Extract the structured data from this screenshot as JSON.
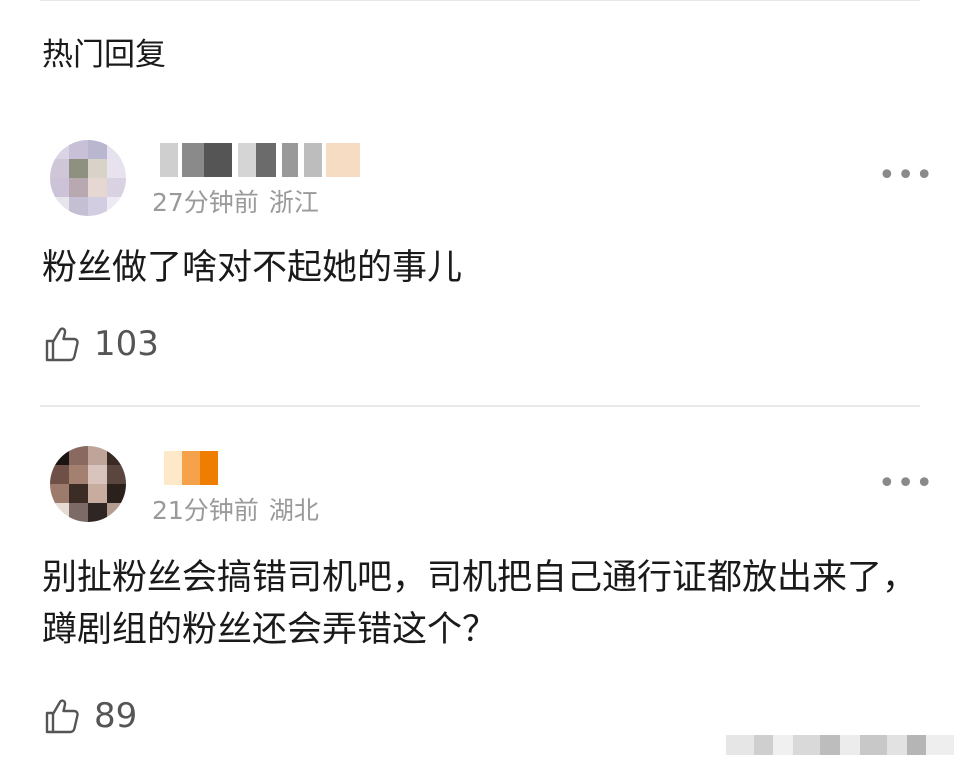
{
  "header": {
    "title": "热门回复"
  },
  "comments": [
    {
      "time": "27分钟前",
      "location": "浙江",
      "text": "粉丝做了啥对不起她的事儿",
      "likes": "103",
      "more": "•••",
      "colors": {
        "avatar": [
          "#d9d3e6",
          "#c7c0d6",
          "#b9b6d0",
          "#e5e1ee",
          "#cfc6d8",
          "#8e9080",
          "#d9d2c8",
          "#e7e2ee",
          "#cdc3d9",
          "#b8a8b0",
          "#e6d7d2",
          "#d8d2e2",
          "#e8e4ee",
          "#c5bfd4",
          "#d2cde0",
          "#eeeaf3"
        ],
        "username": [
          "#cfcfcf",
          "#ffffff",
          "#8a8a8a",
          "#555555",
          "#ffffff",
          "#d5d5d5",
          "#6b6b6b",
          "#ffffff",
          "#999999",
          "#ffffff",
          "#bdbdbd",
          "#ffffff",
          "#f7dcc4"
        ]
      }
    },
    {
      "time": "21分钟前",
      "location": "湖北",
      "text": "别扯粉丝会搞错司机吧，司机把自己通行证都放出来了，蹲剧组的粉丝还会弄错这个？",
      "likes": "89",
      "more": "•••",
      "colors": {
        "avatar": [
          "#1c1412",
          "#8a6a60",
          "#bfa49a",
          "#3a2a24",
          "#6e5046",
          "#a48070",
          "#d8c4bc",
          "#5a463e",
          "#9c7a6c",
          "#3c2c26",
          "#c8aca0",
          "#2a201c",
          "#e6dcd6",
          "#7c6a66",
          "#2e2624",
          "#b49c90"
        ],
        "username": [
          "#fde8c8",
          "#f6a24a",
          "#ef7d00"
        ]
      }
    }
  ],
  "watermark_colors": [
    "#e6e6e6",
    "#cfcfcf",
    "#f0f0f0",
    "#d9d9d9",
    "#bdbdbd",
    "#ececec",
    "#c8c8c8",
    "#e2e2e2",
    "#b5b5b5",
    "#eeeeee"
  ]
}
